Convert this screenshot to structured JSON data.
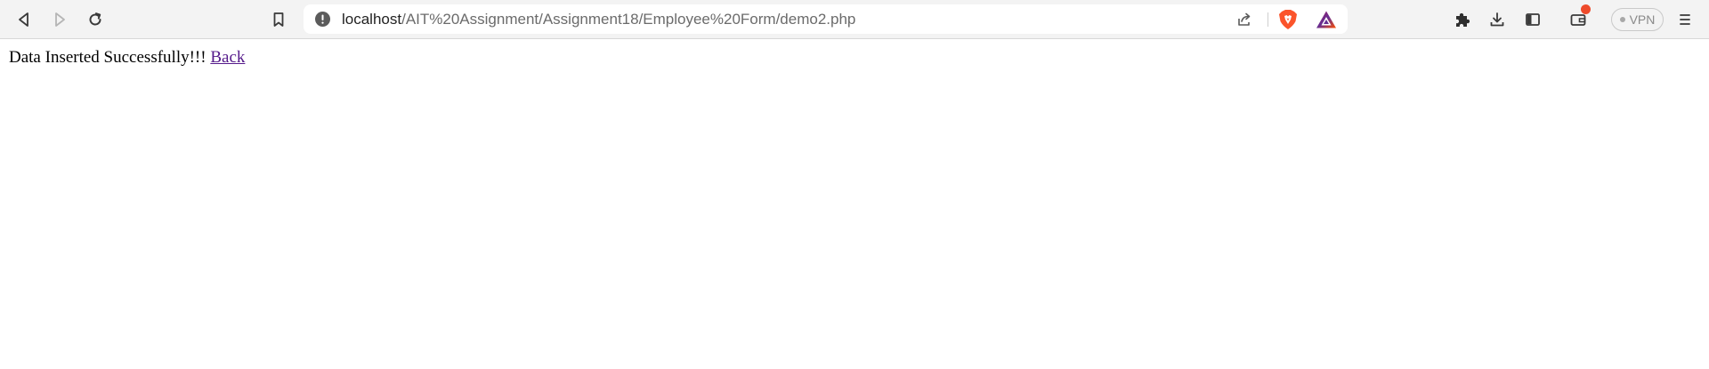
{
  "toolbar": {
    "back_icon": "back-arrow-icon",
    "forward_icon": "forward-arrow-icon",
    "reload_icon": "reload-icon",
    "bookmark_icon": "bookmark-icon"
  },
  "address_bar": {
    "security_icon": "info-warning-icon",
    "url_host": "localhost",
    "url_path": "/AIT%20Assignment/Assignment18/Employee%20Form/demo2.php",
    "share_icon": "share-icon",
    "brave_shield_icon": "brave-shield-icon",
    "rewards_icon": "bat-rewards-icon"
  },
  "right_toolbar": {
    "extensions_icon": "puzzle-icon",
    "downloads_icon": "download-icon",
    "sidebar_icon": "sidebar-icon",
    "wallet_icon": "wallet-icon",
    "vpn_label": "VPN",
    "menu_icon": "hamburger-menu-icon"
  },
  "colors": {
    "toolbar_bg": "#f3f3f3",
    "brave_orange": "#fb542b",
    "link_visited": "#551a8b",
    "wallet_badge": "#ee4b2b"
  },
  "page": {
    "message": "Data Inserted Successfully!!!",
    "back_link": "Back"
  }
}
